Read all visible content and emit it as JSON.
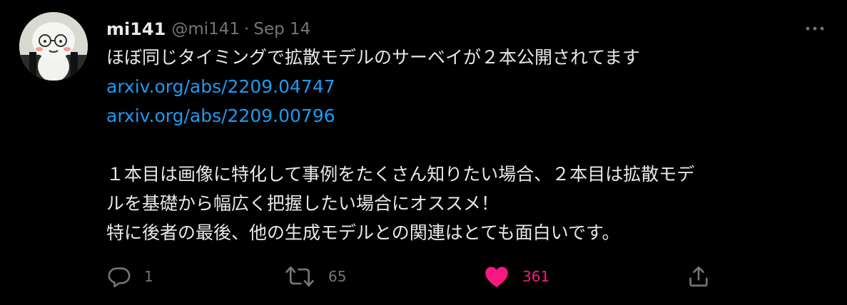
{
  "tweet": {
    "display_name": "mi141",
    "handle": "@mi141",
    "separator": "·",
    "date": "Sep 14",
    "text_lines": [
      "ほぼ同じタイミングで拡散モデルのサーベイが２本公開されてます"
    ],
    "links": [
      "arxiv.org/abs/2209.04747",
      "arxiv.org/abs/2209.00796"
    ],
    "paragraph2": [
      "１本目は画像に特化して事例をたくさん知りたい場合、２本目は拡散モデ",
      "ルを基礎から幅広く把握したい場合にオススメ！",
      "特に後者の最後、他の生成モデルとの関連はとても面白いです。"
    ]
  },
  "actions": {
    "reply_count": "1",
    "retweet_count": "65",
    "like_count": "361"
  },
  "colors": {
    "background": "#000000",
    "text": "#e7e9ea",
    "secondary": "#71767b",
    "link": "#1d9bf0",
    "like": "#f91880"
  },
  "icons": {
    "more": "more-icon",
    "reply": "reply-icon",
    "retweet": "retweet-icon",
    "like": "heart-icon",
    "share": "share-icon"
  }
}
